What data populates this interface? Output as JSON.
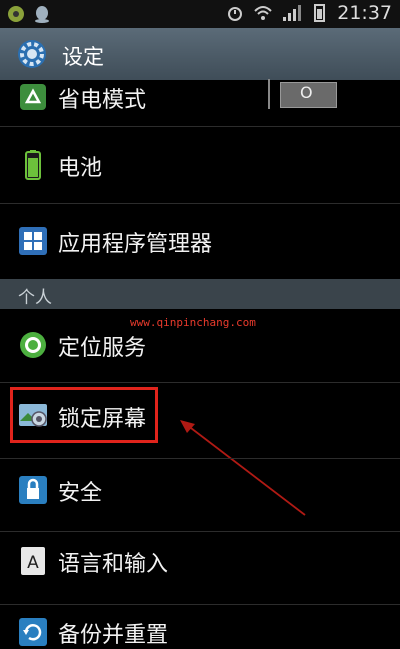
{
  "status_bar": {
    "time": "21:37"
  },
  "header": {
    "title": "设定"
  },
  "items": {
    "power_saving": {
      "label": "省电模式",
      "toggle_state": "O"
    },
    "battery": {
      "label": "电池"
    },
    "app_manager": {
      "label": "应用程序管理器"
    },
    "location": {
      "label": "定位服务"
    },
    "lock_screen": {
      "label": "锁定屏幕"
    },
    "security": {
      "label": "安全"
    },
    "language": {
      "label": "语言和输入"
    },
    "backup": {
      "label": "备份并重置"
    }
  },
  "section_personal": {
    "label": "个人"
  },
  "watermark": "www.qinpinchang.com",
  "colors": {
    "highlight": "#e0241c",
    "titlebar": "#4d5b66",
    "section": "#3a444b"
  }
}
